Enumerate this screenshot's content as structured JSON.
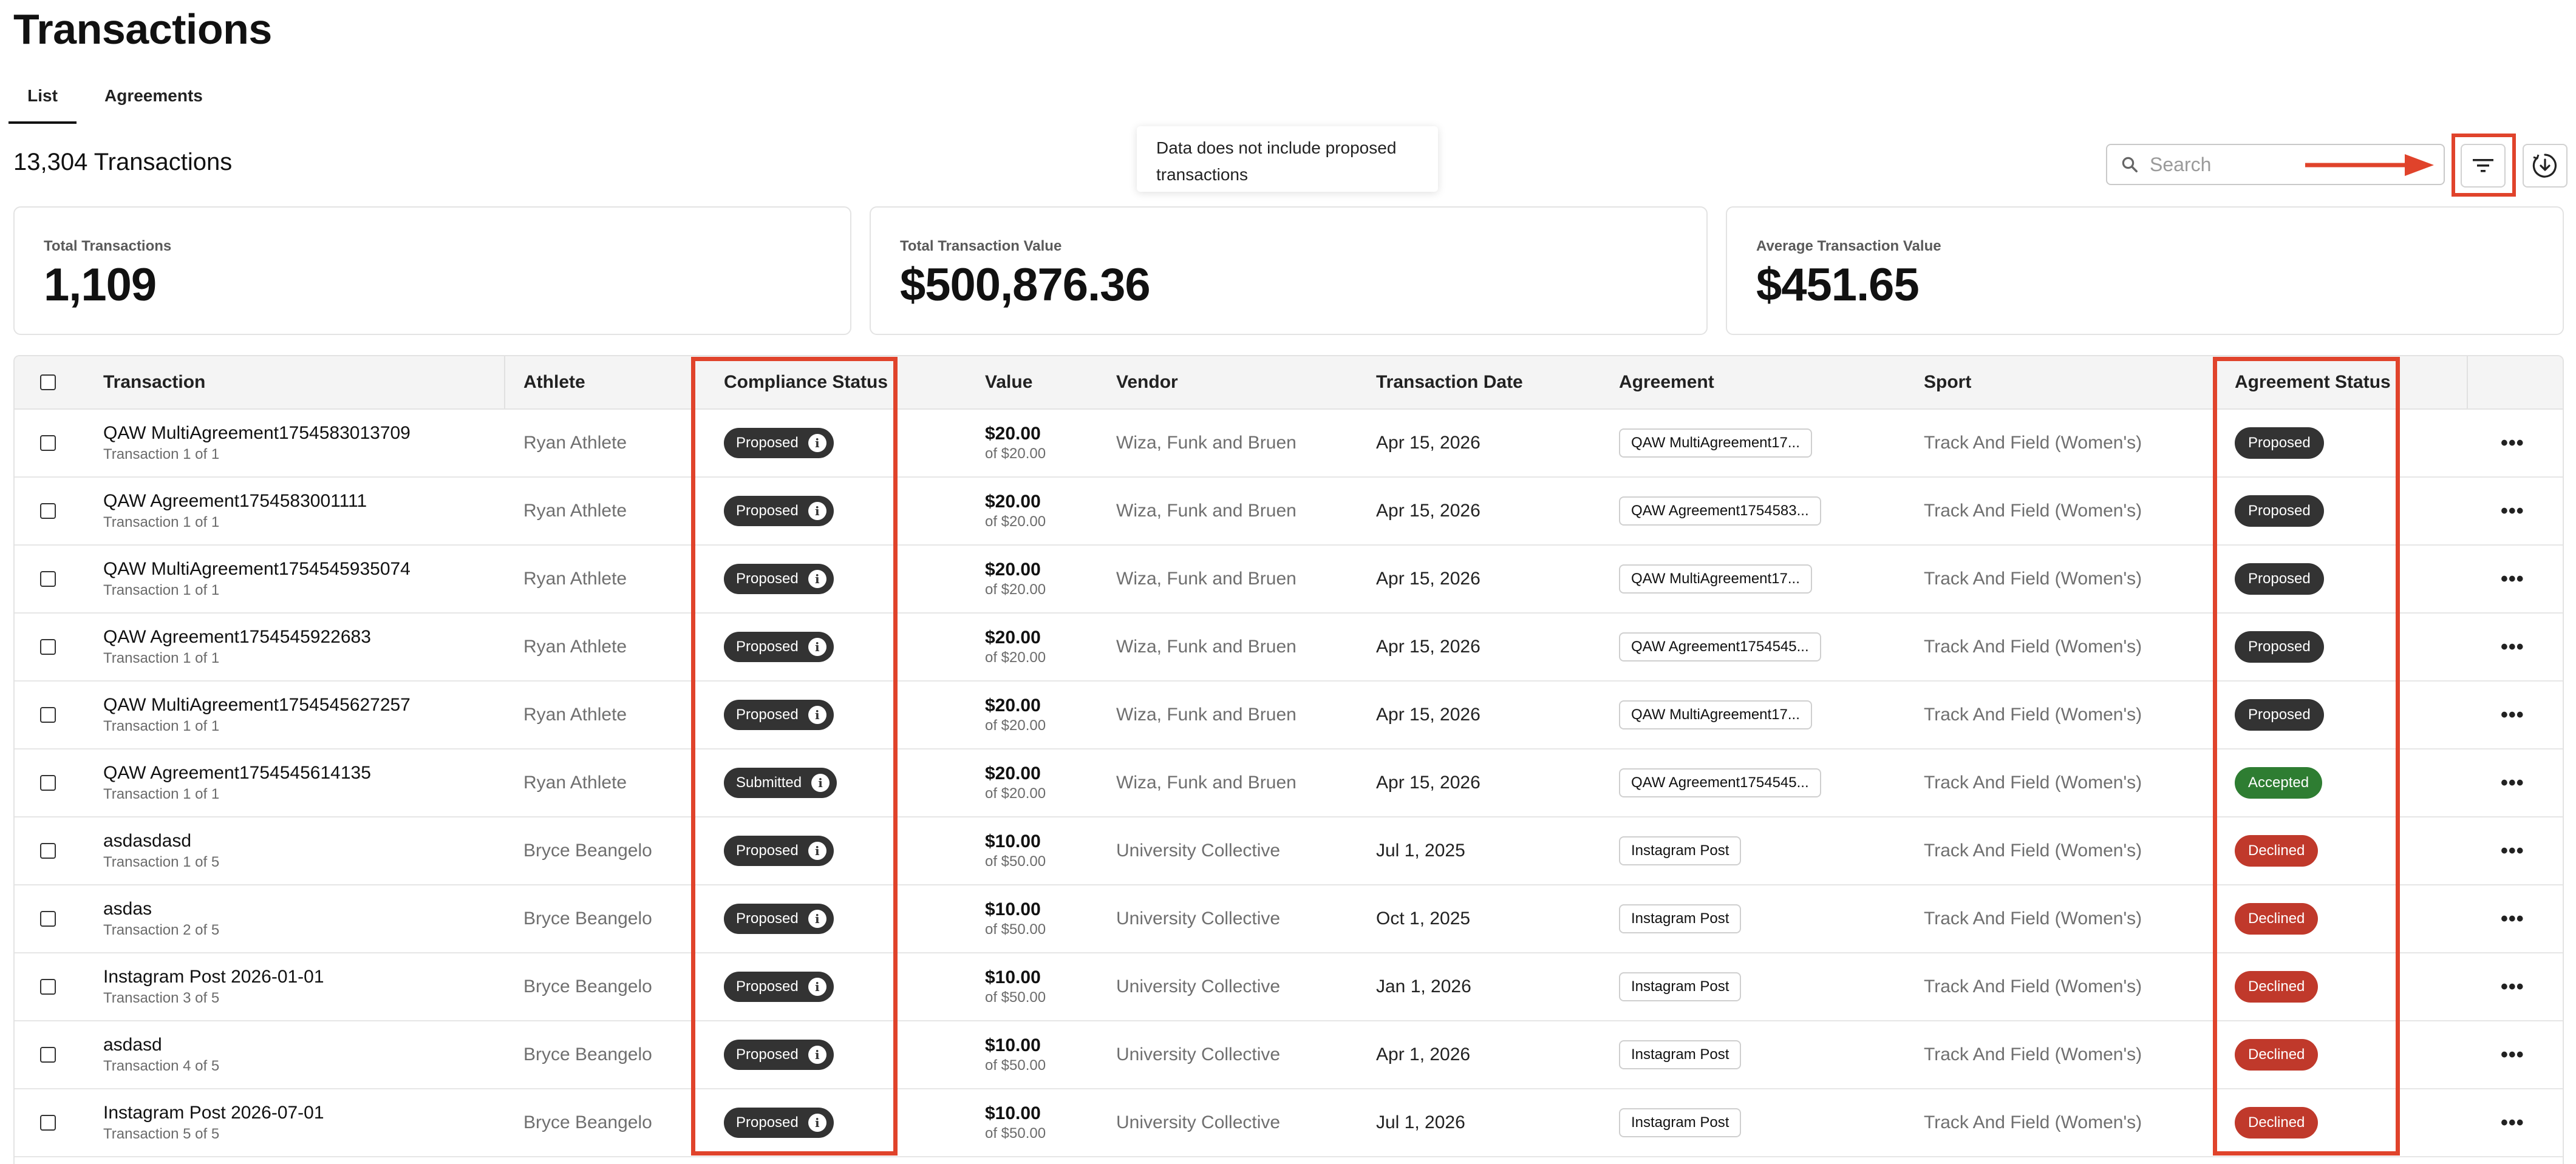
{
  "page": {
    "title": "Transactions"
  },
  "tabs": [
    {
      "label": "List",
      "active": true
    },
    {
      "label": "Agreements",
      "active": false
    }
  ],
  "summary": {
    "count_label": "13,304 Transactions"
  },
  "tooltip": {
    "text": "Data does not include proposed transactions"
  },
  "toolbar": {
    "search_placeholder": "Search",
    "filter_icon": "filter-icon",
    "export_icon": "download-icon"
  },
  "colors": {
    "annotation": "#e0432b",
    "proposed": "#333333",
    "accepted": "#2e7d32",
    "declined": "#c0392b"
  },
  "stats": [
    {
      "label": "Total Transactions",
      "value": "1,109"
    },
    {
      "label": "Total Transaction Value",
      "value": "$500,876.36"
    },
    {
      "label": "Average Transaction Value",
      "value": "$451.65"
    }
  ],
  "table": {
    "headers": {
      "transaction": "Transaction",
      "athlete": "Athlete",
      "compliance": "Compliance Status",
      "value": "Value",
      "vendor": "Vendor",
      "date": "Transaction Date",
      "agreement": "Agreement",
      "sport": "Sport",
      "agreement_status": "Agreement Status"
    },
    "rows": [
      {
        "name": "QAW MultiAgreement1754583013709",
        "sub": "Transaction 1 of 1",
        "athlete": "Ryan Athlete",
        "compliance": "Proposed",
        "value": "$20.00",
        "value_of": "of $20.00",
        "vendor": "Wiza, Funk and Bruen",
        "date": "Apr 15, 2026",
        "agreement": "QAW MultiAgreement17...",
        "sport": "Track And Field (Women's)",
        "status": "Proposed",
        "status_color": "#333333"
      },
      {
        "name": "QAW Agreement1754583001111",
        "sub": "Transaction 1 of 1",
        "athlete": "Ryan Athlete",
        "compliance": "Proposed",
        "value": "$20.00",
        "value_of": "of $20.00",
        "vendor": "Wiza, Funk and Bruen",
        "date": "Apr 15, 2026",
        "agreement": "QAW Agreement1754583...",
        "sport": "Track And Field (Women's)",
        "status": "Proposed",
        "status_color": "#333333"
      },
      {
        "name": "QAW MultiAgreement1754545935074",
        "sub": "Transaction 1 of 1",
        "athlete": "Ryan Athlete",
        "compliance": "Proposed",
        "value": "$20.00",
        "value_of": "of $20.00",
        "vendor": "Wiza, Funk and Bruen",
        "date": "Apr 15, 2026",
        "agreement": "QAW MultiAgreement17...",
        "sport": "Track And Field (Women's)",
        "status": "Proposed",
        "status_color": "#333333"
      },
      {
        "name": "QAW Agreement1754545922683",
        "sub": "Transaction 1 of 1",
        "athlete": "Ryan Athlete",
        "compliance": "Proposed",
        "value": "$20.00",
        "value_of": "of $20.00",
        "vendor": "Wiza, Funk and Bruen",
        "date": "Apr 15, 2026",
        "agreement": "QAW Agreement1754545...",
        "sport": "Track And Field (Women's)",
        "status": "Proposed",
        "status_color": "#333333"
      },
      {
        "name": "QAW MultiAgreement1754545627257",
        "sub": "Transaction 1 of 1",
        "athlete": "Ryan Athlete",
        "compliance": "Proposed",
        "value": "$20.00",
        "value_of": "of $20.00",
        "vendor": "Wiza, Funk and Bruen",
        "date": "Apr 15, 2026",
        "agreement": "QAW MultiAgreement17...",
        "sport": "Track And Field (Women's)",
        "status": "Proposed",
        "status_color": "#333333"
      },
      {
        "name": "QAW Agreement1754545614135",
        "sub": "Transaction 1 of 1",
        "athlete": "Ryan Athlete",
        "compliance": "Submitted",
        "value": "$20.00",
        "value_of": "of $20.00",
        "vendor": "Wiza, Funk and Bruen",
        "date": "Apr 15, 2026",
        "agreement": "QAW Agreement1754545...",
        "sport": "Track And Field (Women's)",
        "status": "Accepted",
        "status_color": "#2e7d32"
      },
      {
        "name": "asdasdasd",
        "sub": "Transaction 1 of 5",
        "athlete": "Bryce Beangelo",
        "compliance": "Proposed",
        "value": "$10.00",
        "value_of": "of $50.00",
        "vendor": "University Collective",
        "date": "Jul 1, 2025",
        "agreement": "Instagram Post",
        "sport": "Track And Field (Women's)",
        "status": "Declined",
        "status_color": "#c0392b"
      },
      {
        "name": "asdas",
        "sub": "Transaction 2 of 5",
        "athlete": "Bryce Beangelo",
        "compliance": "Proposed",
        "value": "$10.00",
        "value_of": "of $50.00",
        "vendor": "University Collective",
        "date": "Oct 1, 2025",
        "agreement": "Instagram Post",
        "sport": "Track And Field (Women's)",
        "status": "Declined",
        "status_color": "#c0392b"
      },
      {
        "name": "Instagram Post 2026-01-01",
        "sub": "Transaction 3 of 5",
        "athlete": "Bryce Beangelo",
        "compliance": "Proposed",
        "value": "$10.00",
        "value_of": "of $50.00",
        "vendor": "University Collective",
        "date": "Jan 1, 2026",
        "agreement": "Instagram Post",
        "sport": "Track And Field (Women's)",
        "status": "Declined",
        "status_color": "#c0392b"
      },
      {
        "name": "asdasd",
        "sub": "Transaction 4 of 5",
        "athlete": "Bryce Beangelo",
        "compliance": "Proposed",
        "value": "$10.00",
        "value_of": "of $50.00",
        "vendor": "University Collective",
        "date": "Apr 1, 2026",
        "agreement": "Instagram Post",
        "sport": "Track And Field (Women's)",
        "status": "Declined",
        "status_color": "#c0392b"
      },
      {
        "name": "Instagram Post 2026-07-01",
        "sub": "Transaction 5 of 5",
        "athlete": "Bryce Beangelo",
        "compliance": "Proposed",
        "value": "$10.00",
        "value_of": "of $50.00",
        "vendor": "University Collective",
        "date": "Jul 1, 2026",
        "agreement": "Instagram Post",
        "sport": "Track And Field (Women's)",
        "status": "Declined",
        "status_color": "#c0392b"
      }
    ]
  }
}
